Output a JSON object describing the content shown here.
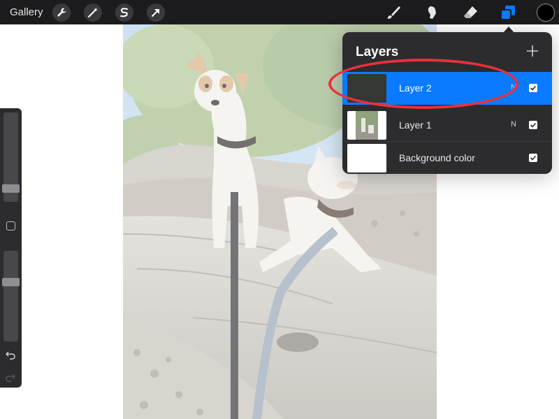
{
  "toolbar": {
    "gallery_label": "Gallery",
    "actions": [
      {
        "icon": "wrench-icon"
      },
      {
        "icon": "magic-wand-icon"
      },
      {
        "icon": "selection-icon"
      },
      {
        "icon": "transform-arrow-icon"
      }
    ],
    "tools": [
      {
        "icon": "brush-icon"
      },
      {
        "icon": "smudge-icon"
      },
      {
        "icon": "eraser-icon"
      },
      {
        "icon": "layers-icon",
        "active": true
      }
    ],
    "current_color": "#000000"
  },
  "sidebar": {
    "size_slider_value": 0.73,
    "opacity_slider_value": 0.35,
    "undo_icon": "undo-icon",
    "redo_icon": "redo-icon"
  },
  "layers_panel": {
    "title": "Layers",
    "add_icon": "plus-icon",
    "layers": [
      {
        "name": "Layer 2",
        "blend_mode": "N",
        "visible": true,
        "selected": true,
        "thumbnail": "#353833"
      },
      {
        "name": "Layer 1",
        "blend_mode": "N",
        "visible": true,
        "selected": false,
        "thumbnail": "photo"
      },
      {
        "name": "Background color",
        "blend_mode": "",
        "visible": true,
        "selected": false,
        "thumbnail": "#ffffff"
      }
    ]
  },
  "colors": {
    "accent": "#0a7aff",
    "toolbar_bg": "#1c1c1e",
    "panel_bg": "#2c2c2e",
    "annotation": "#e8323c"
  }
}
